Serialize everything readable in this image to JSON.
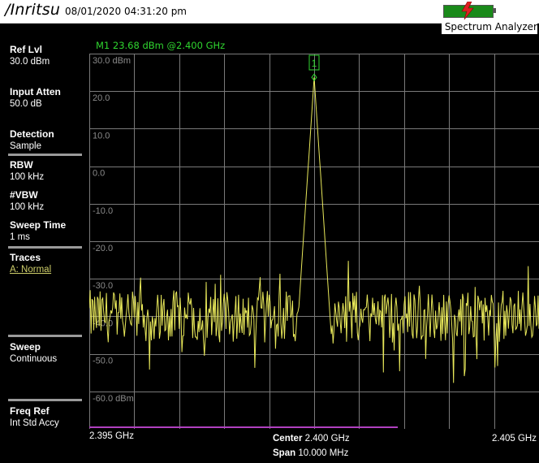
{
  "header": {
    "brand": "/Inritsu",
    "datetime": "08/01/2020 04:31:20 pm",
    "mode": "Spectrum Analyzer"
  },
  "marker": {
    "readout": "M1 23.68 dBm @2.400 GHz",
    "label": "1",
    "freq_ghz": 2.4,
    "level_dbm": 23.68
  },
  "sidebar": {
    "ref_lvl": {
      "label": "Ref Lvl",
      "value": "30.0 dBm"
    },
    "input_atten": {
      "label": "Input Atten",
      "value": "50.0 dB"
    },
    "detection": {
      "label": "Detection",
      "value": "Sample"
    },
    "rbw": {
      "label": "RBW",
      "value": "100 kHz"
    },
    "vbw": {
      "label": "#VBW",
      "value": "100 kHz"
    },
    "sweep_time": {
      "label": "Sweep Time",
      "value": "1 ms"
    },
    "traces": {
      "label": "Traces",
      "value": "A: Normal"
    },
    "sweep": {
      "label": "Sweep",
      "value": "Continuous"
    },
    "freq_ref": {
      "label": "Freq Ref",
      "value": "Int Std Accy"
    }
  },
  "xaxis": {
    "start": "2.395 GHz",
    "stop": "2.405 GHz",
    "center_label": "Center",
    "center_value": "2.400 GHz",
    "span_label": "Span",
    "span_value": "10.000 MHz"
  },
  "colors": {
    "trace": "#e8e85a",
    "grid": "#7a7a7a",
    "marker": "#2fd52f",
    "limit_line": "#b040c0"
  },
  "chart_data": {
    "type": "line",
    "series": [
      {
        "x_start_ghz": 2.395,
        "x_stop_ghz": 2.405,
        "peak_x_ghz": 2.4,
        "peak_y_dbm": 23.68,
        "noise_floor_dbm": -40,
        "noise_spread_dbm": 7,
        "points": 501
      }
    ],
    "ylim": [
      -70,
      30
    ],
    "xlim": [
      2.395,
      2.405
    ],
    "yticks": [
      "30.0 dBm",
      "20.0",
      "10.0",
      "0.0",
      "-10.0",
      "-20.0",
      "-30.0",
      "-40.0",
      "-50.0",
      "-60.0 dBm"
    ],
    "grid": true
  }
}
